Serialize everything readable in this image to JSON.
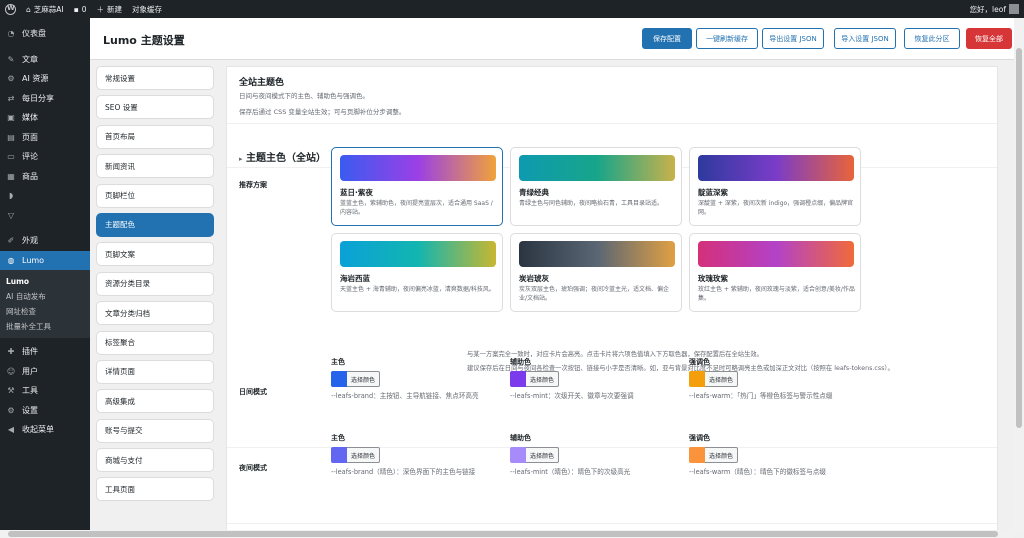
{
  "adminbar": {
    "site_name": "芝麻蒜AI",
    "comments_count": "0",
    "new_label": "新建",
    "cache_label": "对象缓存",
    "greeting": "您好，leof"
  },
  "sidebar": {
    "items": [
      {
        "label": "仪表盘",
        "icon": "dashboard-icon"
      },
      {
        "label": "文章",
        "icon": "pin-icon"
      },
      {
        "label": "AI 资源",
        "icon": "gear-icon"
      },
      {
        "label": "每日分享",
        "icon": "share-icon"
      },
      {
        "label": "媒体",
        "icon": "media-icon"
      },
      {
        "label": "页面",
        "icon": "page-icon"
      },
      {
        "label": "评论",
        "icon": "comment-icon"
      },
      {
        "label": "商品",
        "icon": "cart-icon"
      },
      {
        "label": "",
        "icon": "rss-icon"
      },
      {
        "label": "",
        "icon": "filter-icon"
      },
      {
        "label": "外观",
        "icon": "brush-icon"
      },
      {
        "label": "Lumo",
        "icon": "globe-icon"
      }
    ],
    "submenu": [
      "Lumo",
      "AI 自动发布",
      "网址检查",
      "批量补全工具"
    ],
    "items2": [
      {
        "label": "插件",
        "icon": "plugin-icon"
      },
      {
        "label": "用户",
        "icon": "user-icon"
      },
      {
        "label": "工具",
        "icon": "wrench-icon"
      },
      {
        "label": "设置",
        "icon": "settings-icon"
      },
      {
        "label": "收起菜单",
        "icon": "collapse-icon"
      }
    ]
  },
  "header": {
    "title": "Lumo 主题设置",
    "buttons": [
      "保存配置",
      "一键刷新缓存",
      "导出设置 JSON",
      "导入设置 JSON",
      "恢复此分区",
      "恢复全部"
    ]
  },
  "tabs": [
    "常规设置",
    "SEO 设置",
    "首页布局",
    "新闻资讯",
    "页脚栏位",
    "主题配色",
    "页脚文案",
    "资源分类目录",
    "文章分类归档",
    "标签聚合",
    "详情页面",
    "高级集成",
    "账号与提交",
    "商城与支付",
    "工具页面"
  ],
  "section": {
    "title": "全站主题色",
    "desc1": "日间与夜间模式下的主色、辅助色与强调色。",
    "desc2": "保存后通过 CSS 变量全站生效；可与页脚补位分步调整。",
    "heading": "主题主色（全站）",
    "presets_label": "推荐方案",
    "day_label": "日间模式",
    "night_label": "夜间模式"
  },
  "presets": [
    {
      "name": "蓝日·紫夜",
      "desc": "蓝蓝主色，紫辅助色，夜间提亮蓝层次，适合通用 SaaS / 内容站。",
      "from": "#3a5bf0",
      "mid": "#9b40e6",
      "to": "#f0a23a"
    },
    {
      "name": "青绿经典",
      "desc": "青绿主色与同色辅助，夜间略抬石青，工具目录站适。",
      "from": "#0e9ab0",
      "mid": "#17a58a",
      "to": "#c9b24a"
    },
    {
      "name": "靛蓝深紫",
      "desc": "深靛蓝 + 深紫，夜间次新 indigo，强调橙点缀，偏品牌官网。",
      "from": "#2e3a9e",
      "mid": "#7a3cc8",
      "to": "#e8643a"
    },
    {
      "name": "海岩西蓝",
      "desc": "天蓝主色 + 海青辅助，夜间偏亮冰蓝，清爽数据/科技风。",
      "from": "#0aa1d8",
      "mid": "#13b5b0",
      "to": "#c7b731"
    },
    {
      "name": "炭岩琥灰",
      "desc": "炭灰双层主色，琥珀强调；夜间冷蓝主光，适文档、偏企业/文档站。",
      "from": "#2b3542",
      "mid": "#5a6674",
      "to": "#e0a043"
    },
    {
      "name": "玫瑰玫紫",
      "desc": "玫红主色 + 紫辅助，夜间玫瑰与淡紫，适合创意/美妆/作品集。",
      "from": "#d4307a",
      "mid": "#b342c8",
      "to": "#f06a3a"
    }
  ],
  "notes": [
    "与某一方案完全一致时，对应卡片会高亮。点击卡片将六项色值填入下方取色器，保存配置后在全站生效。",
    "建议保存后在日间与夜间各检查一次按钮、链接与小字是否清晰。如，亚与背景对比度不足时可略调亮主色或加深正文对比（按照在 leafs-tokens.css）。"
  ],
  "day": [
    {
      "label": "主色",
      "btn": "选择颜色",
      "desc": "--leafs-brand：主按钮、主导航链接、焦点环高亮",
      "color": "#2563eb"
    },
    {
      "label": "辅助色",
      "btn": "选择颜色",
      "desc": "--leafs-mint：次级开关、徽章与次要强调",
      "color": "#7c3aed"
    },
    {
      "label": "强调色",
      "btn": "选择颜色",
      "desc": "--leafs-warm：「热门」等橙色标签与警示性点缀",
      "color": "#f59e0b"
    }
  ],
  "night": [
    {
      "label": "主色",
      "btn": "选择颜色",
      "desc": "--leafs-brand（晴色）：深色界面下的主色与链接",
      "color": "#6366f1"
    },
    {
      "label": "辅助色",
      "btn": "选择颜色",
      "desc": "--leafs-mint（晴色）：晴色下的次级高光",
      "color": "#a78bfa"
    },
    {
      "label": "强调色",
      "btn": "选择颜色",
      "desc": "--leafs-warm（晴色）：晴色下的徽标签与点缀",
      "color": "#fb923c"
    }
  ]
}
